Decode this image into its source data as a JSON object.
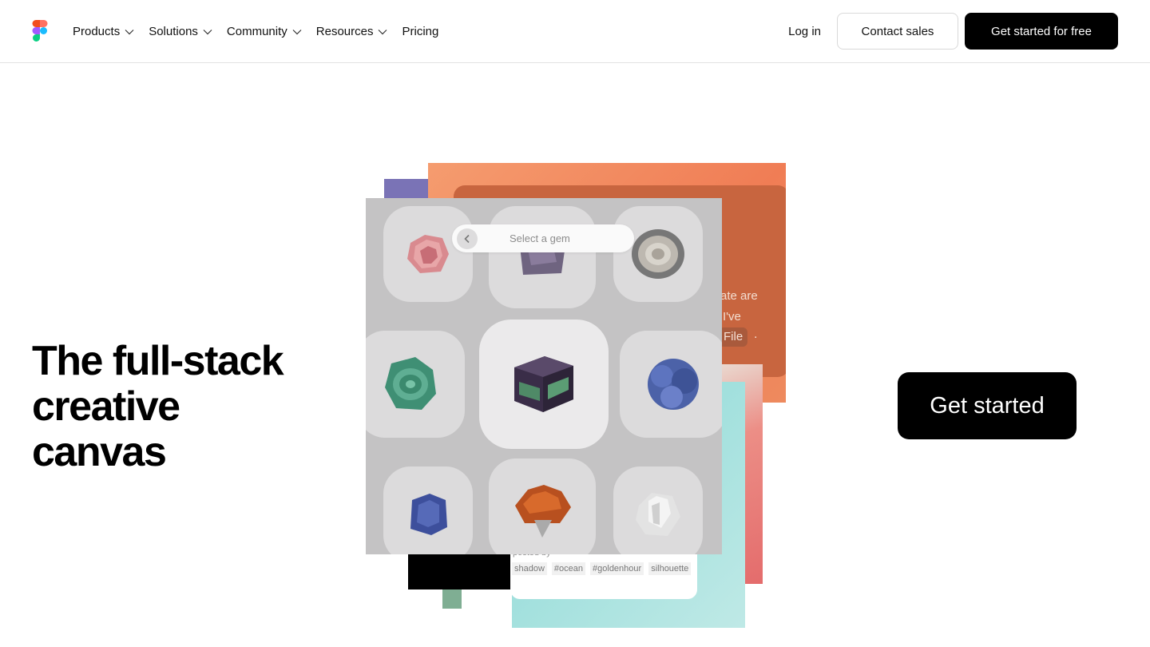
{
  "nav": {
    "items": [
      {
        "label": "Products",
        "has_dropdown": true
      },
      {
        "label": "Solutions",
        "has_dropdown": true
      },
      {
        "label": "Community",
        "has_dropdown": true
      },
      {
        "label": "Resources",
        "has_dropdown": true
      },
      {
        "label": "Pricing",
        "has_dropdown": false
      }
    ],
    "login": "Log in",
    "contact_sales": "Contact sales",
    "get_started_free": "Get started for free"
  },
  "hero": {
    "headline": [
      "The full-stack",
      "creative",
      "canvas"
    ],
    "cta": "Get started"
  },
  "collage": {
    "search_placeholder": "Select a gem",
    "orange_text_lines": [
      "ate are",
      "I've"
    ],
    "file_chip": "File",
    "file_dot": ".",
    "posted_by": "posted by",
    "tags": [
      "shadow",
      "#ocean",
      "#goldenhour",
      "silhouette"
    ]
  },
  "colors": {
    "brand_black": "#000000",
    "purple_card": "#7a73b6",
    "orange_card": "#f07d55",
    "teal_card": "#9edfdc",
    "gem_panel": "#c4c3c4"
  }
}
